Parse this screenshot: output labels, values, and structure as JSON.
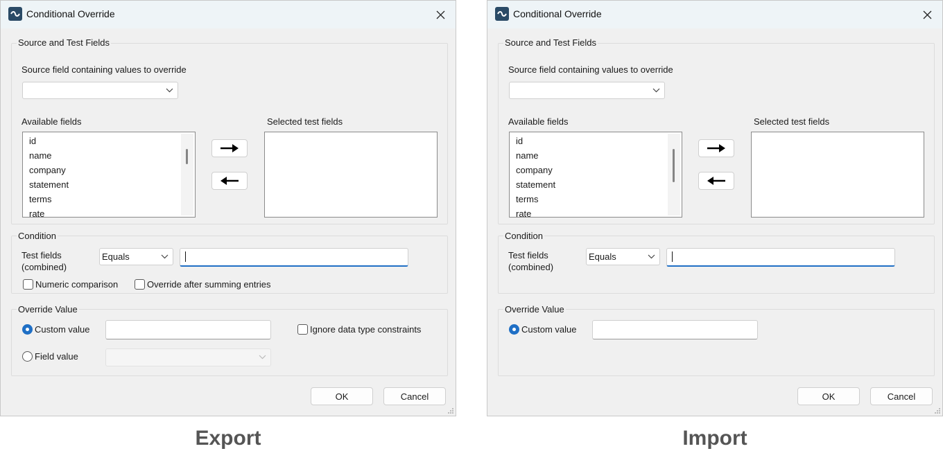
{
  "dialog_title": "Conditional Override",
  "source_group": {
    "label": "Source and Test Fields",
    "source_field_label": "Source field containing values to override",
    "source_field_value": "",
    "available_label": "Available fields",
    "available_items": [
      "id",
      "name",
      "company",
      "statement",
      "terms",
      "rate"
    ],
    "selected_label": "Selected test fields"
  },
  "condition_group": {
    "label": "Condition",
    "test_fields_label_line1": "Test fields",
    "test_fields_label_line2": "(combined)",
    "operator_value": "Equals",
    "numeric_label": "Numeric comparison",
    "summing_label": "Override after summing entries"
  },
  "override_group": {
    "label": "Override Value",
    "custom_label": "Custom value",
    "field_label": "Field value",
    "ignore_label": "Ignore data type constraints"
  },
  "buttons": {
    "ok": "OK",
    "cancel": "Cancel"
  },
  "captions": {
    "left": "Export",
    "right": "Import"
  },
  "icons": [
    "app-logo-icon",
    "close-icon",
    "chevron-down-icon",
    "arrow-right-icon",
    "arrow-left-icon",
    "resize-grip-icon"
  ],
  "colors": {
    "accent": "#1f6fc5",
    "titlebar": "#eef4f7",
    "dialog_bg": "#f0f0f0"
  }
}
